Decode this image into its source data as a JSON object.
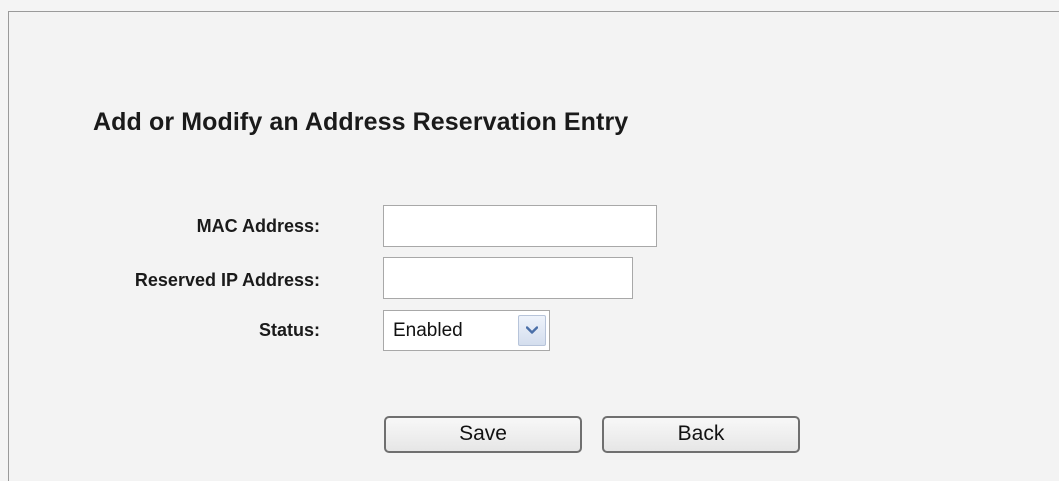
{
  "page": {
    "title": "Add or Modify an Address Reservation Entry"
  },
  "form": {
    "mac_label": "MAC Address:",
    "mac_value": "",
    "ip_label": "Reserved IP Address:",
    "ip_value": "",
    "status_label": "Status:",
    "status_selected": "Enabled"
  },
  "buttons": {
    "save_label": "Save",
    "back_label": "Back"
  },
  "icons": {
    "select_arrow": "chevron-down-icon"
  },
  "colors": {
    "background": "#f3f3f3",
    "select_arrow_accent": "#4a6fa8"
  }
}
